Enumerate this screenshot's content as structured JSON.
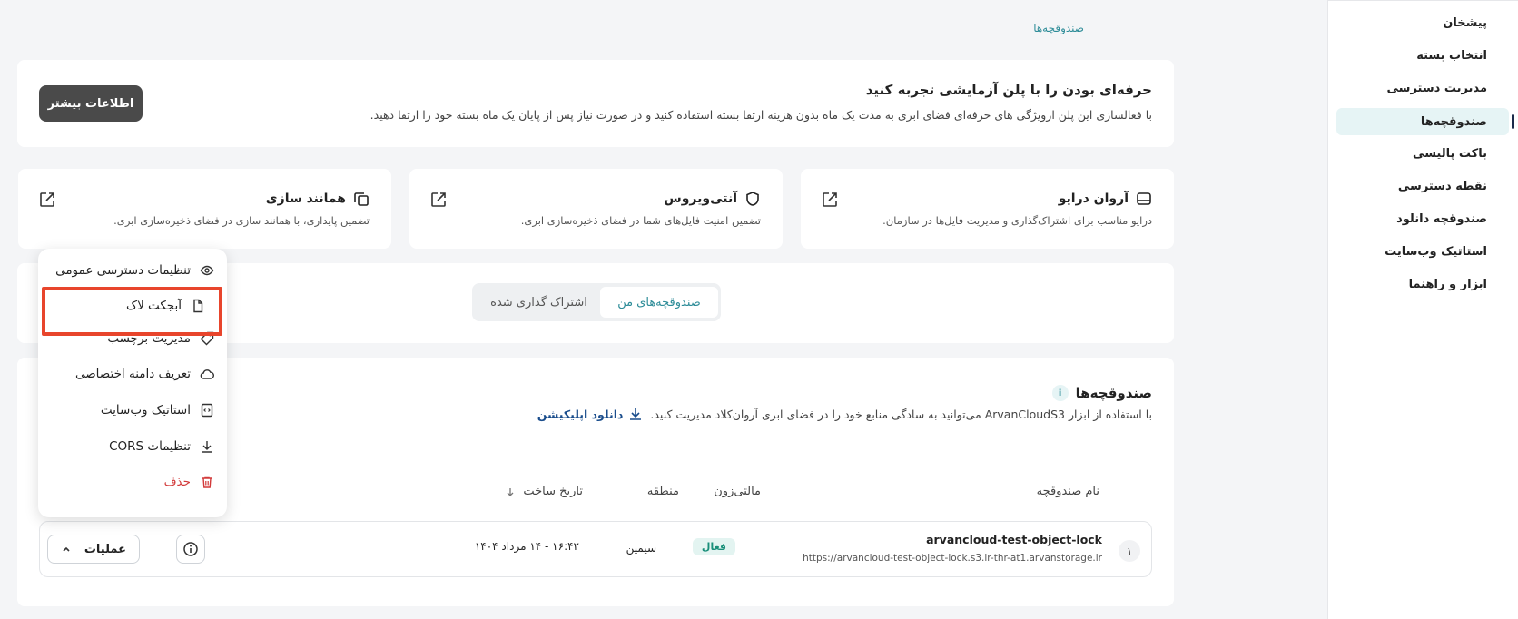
{
  "sidebar": {
    "items": [
      {
        "label": "پیشخان",
        "active": false
      },
      {
        "label": "انتخاب بسته",
        "active": false
      },
      {
        "label": "مدیریت دسترسی",
        "active": false
      },
      {
        "label": "صندوقچه‌ها",
        "active": true
      },
      {
        "label": "باکت پالیسی",
        "active": false
      },
      {
        "label": "نقطه دسترسی",
        "active": false
      },
      {
        "label": "صندوقچه دانلود",
        "active": false
      },
      {
        "label": "استاتیک وب‌سایت",
        "active": false
      },
      {
        "label": "ابزار و راهنما",
        "active": false
      }
    ]
  },
  "breadcrumb": "صندوقچه‌ها",
  "promo": {
    "title": "حرفه‌ای بودن را با پلن آزمایشی تجربه کنید",
    "description": "با فعالسازی این پلن ازویژگی های حرفه‌ای فضای ابری به مدت یک ماه بدون هزینه ارتقا بسته استفاده کنید و در صورت نیاز پس از پایان یک ماه بسته خود را ارتقا دهید.",
    "button": "اطلاعات بیشتر"
  },
  "features": [
    {
      "title": "آروان درایو",
      "description": "درایو مناسب برای اشتراک‌گذاری و مدیریت فایل‌ها در سازمان.",
      "icon": "drive-icon"
    },
    {
      "title": "آنتی‌ویروس",
      "description": "تضمین امنیت فایل‌های شما در فضای ذخیره‌سازی ابری.",
      "icon": "shield-icon"
    },
    {
      "title": "همانند سازی",
      "description": "تضمین پایداری، با همانند سازی در فضای ذخیره‌سازی ابری.",
      "icon": "copy-icon"
    }
  ],
  "tabs": {
    "mine": "صندوقچه‌های من",
    "shared": "اشتراک گذاری شده"
  },
  "buckets": {
    "title": "صندوقچه‌ها",
    "description": "با استفاده از ابزار ArvanCloudS3 می‌توانید به سادگی منابع خود را در فضای ابری آروان‌کلاد مدیریت کنید.",
    "download_link": "دانلود اپلیکیشن",
    "columns": {
      "name": "نام صندوقچه",
      "multizone": "مالتی‌زون",
      "region": "منطقه",
      "created": "تاریخ ساخت"
    },
    "rows": [
      {
        "index": "۱",
        "name": "arvancloud-test-object-lock",
        "url": "https://arvancloud-test-object-lock.s3.ir-thr-at1.arvanstorage.ir",
        "status": "فعال",
        "region": "سیمین",
        "date": "۱۶:۴۲ - ۱۴ مرداد ۱۴۰۴",
        "ops_label": "عملیات"
      }
    ]
  },
  "dropdown": {
    "items": [
      {
        "label": "تنظیمات دسترسی عمومی",
        "icon": "eye-icon"
      },
      {
        "label": "آبجکت لاک",
        "icon": "file-icon"
      },
      {
        "label": "مدیریت برچسب",
        "icon": "tag-icon"
      },
      {
        "label": "تعریف دامنه اختصاصی",
        "icon": "cloud-icon"
      },
      {
        "label": "استاتیک وب‌سایت",
        "icon": "code-file-icon"
      },
      {
        "label": "تنظیمات CORS",
        "icon": "download-icon"
      },
      {
        "label": "حذف",
        "icon": "trash-icon"
      }
    ]
  },
  "colors": {
    "accent": "#2d8c98",
    "highlight": "#e8452c",
    "danger": "#d23a3a"
  }
}
